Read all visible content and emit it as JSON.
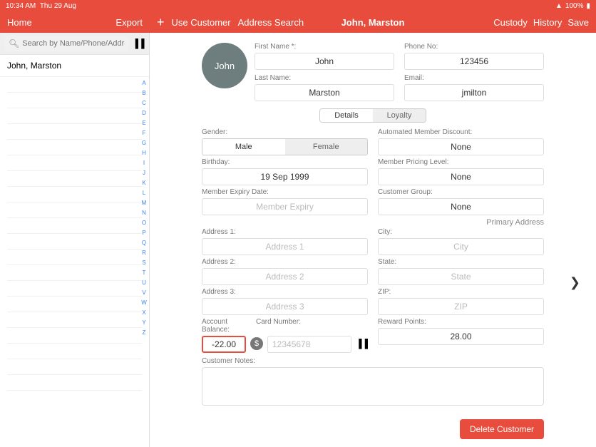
{
  "status": {
    "time": "10:34 AM",
    "date": "Thu 29 Aug",
    "battery": "100%",
    "wifi": "wifi"
  },
  "header": {
    "left": {
      "home": "Home",
      "export": "Export"
    },
    "right": {
      "use_customer": "Use Customer",
      "address_search": "Address Search",
      "title": "John, Marston",
      "custody": "Custody",
      "history": "History",
      "save": "Save"
    }
  },
  "sidebar": {
    "search_placeholder": "Search by Name/Phone/Addre...",
    "selected": "John, Marston",
    "index": [
      "A",
      "B",
      "C",
      "D",
      "E",
      "F",
      "G",
      "H",
      "I",
      "J",
      "K",
      "L",
      "M",
      "N",
      "O",
      "P",
      "Q",
      "R",
      "S",
      "T",
      "U",
      "V",
      "W",
      "X",
      "Y",
      "Z"
    ]
  },
  "customer": {
    "avatar": "John",
    "first_name_label": "First Name *:",
    "first_name": "John",
    "last_name_label": "Last Name:",
    "last_name": "Marston",
    "phone_label": "Phone No:",
    "phone": "123456",
    "email_label": "Email:",
    "email": "jmilton"
  },
  "tabs": {
    "details": "Details",
    "loyalty": "Loyalty"
  },
  "details": {
    "gender_label": "Gender:",
    "gender_male": "Male",
    "gender_female": "Female",
    "discount_label": "Automated Member Discount:",
    "discount": "None",
    "birthday_label": "Birthday:",
    "birthday": "19 Sep 1999",
    "pricing_label": "Member Pricing Level:",
    "pricing": "None",
    "expiry_label": "Member Expiry Date:",
    "expiry_placeholder": "Member Expiry",
    "group_label": "Customer Group:",
    "group": "None",
    "primary_addr": "Primary Address",
    "address1_label": "Address 1:",
    "address1_placeholder": "Address 1",
    "city_label": "City:",
    "city_placeholder": "City",
    "address2_label": "Address 2:",
    "address2_placeholder": "Address 2",
    "state_label": "State:",
    "state_placeholder": "State",
    "address3_label": "Address 3:",
    "address3_placeholder": "Address 3",
    "zip_label": "ZIP:",
    "zip_placeholder": "ZIP",
    "balance_label": "Account Balance:",
    "balance": "-22.00",
    "card_label": "Card Number:",
    "card_placeholder": "12345678",
    "reward_label": "Reward Points:",
    "reward": "28.00",
    "notes_label": "Customer Notes:",
    "delete": "Delete Customer"
  }
}
